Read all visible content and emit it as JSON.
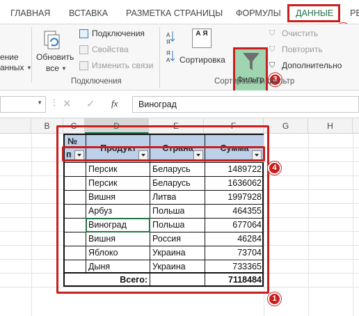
{
  "ribbon_tabs": [
    {
      "label": "ГЛАВНАЯ"
    },
    {
      "label": "ВСТАВКА"
    },
    {
      "label": "РАЗМЕТКА СТРАНИЦЫ"
    },
    {
      "label": "ФОРМУЛЫ"
    },
    {
      "label": "ДАННЫЕ"
    },
    {
      "label": "РЕ"
    }
  ],
  "ribbon": {
    "left_cut": {
      "line1": "ение",
      "line2": "анных"
    },
    "refresh_all": {
      "line1": "Обновить",
      "line2": "все"
    },
    "connections": {
      "connections": "Подключения",
      "properties": "Свойства",
      "edit_links": "Изменить связи",
      "group_label": "Подключения"
    },
    "sort_filter": {
      "sort_label": "Сортировка",
      "az": "А Я",
      "filter_label": "Фильтр",
      "clear": "Очистить",
      "reapply": "Повторить",
      "advanced": "Дополнительно",
      "group_label": "Сортировка и фильтр"
    }
  },
  "formula_bar": {
    "fx": "fx",
    "content": "Виноград"
  },
  "columns": [
    "B",
    "C",
    "D",
    "E",
    "F",
    "G",
    "H"
  ],
  "table": {
    "header_row1": "№",
    "header_row2": "п",
    "headers": [
      "Продукт",
      "Страна",
      "Сумма"
    ],
    "rows": [
      {
        "product": "Персик",
        "country": "Беларусь",
        "sum": "1489722"
      },
      {
        "product": "Персик",
        "country": "Беларусь",
        "sum": "1636062"
      },
      {
        "product": "Вишня",
        "country": "Литва",
        "sum": "1997928"
      },
      {
        "product": "Арбуз",
        "country": "Польша",
        "sum": "464355"
      },
      {
        "product": "Виноград",
        "country": "Польша",
        "sum": "677064"
      },
      {
        "product": "Вишня",
        "country": "Россия",
        "sum": "46284"
      },
      {
        "product": "Яблоко",
        "country": "Украина",
        "sum": "73704"
      },
      {
        "product": "Дыня",
        "country": "Украина",
        "sum": "733365"
      }
    ],
    "total_label": "Всего:",
    "total_value": "7118484"
  },
  "badges": [
    "1",
    "2",
    "3",
    "4"
  ],
  "colors": {
    "accent_red": "#c81e1e",
    "excel_green": "#217346",
    "filter_highlight": "#9fd5b0",
    "header_fill": "#bcd0ea"
  }
}
